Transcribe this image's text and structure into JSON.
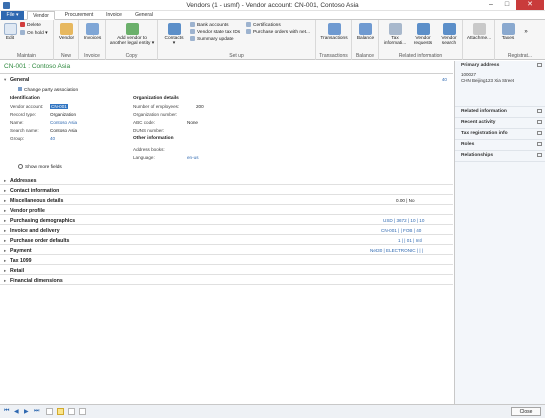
{
  "window": {
    "title": "Vendors (1 - usmf) - Vendor account: CN-001, Contoso Asia"
  },
  "tabs": [
    {
      "label": "File",
      "arrow": "▾"
    },
    {
      "label": "Vendor"
    },
    {
      "label": "Procurement"
    },
    {
      "label": "Invoice"
    },
    {
      "label": "General"
    }
  ],
  "ribbon": {
    "maintain": {
      "label": "Maintain",
      "edit": "Edit",
      "delete": "Delete",
      "on_hold": "On hold"
    },
    "new": {
      "label": "New",
      "vendor": "Vendor"
    },
    "invoice": {
      "label": "Invoice",
      "invoices": "Invoices"
    },
    "copy": {
      "label": "Copy",
      "add_vendor_line1": "Add vendor to",
      "add_vendor_line2": "another legal entity"
    },
    "setup": {
      "label": "Set up",
      "contacts": "Contacts",
      "bank_accounts": "Bank accounts",
      "vendor_state_tax": "Vendor state tax IDs",
      "summary_update": "Summary update",
      "certifications": "Certifications",
      "purchase_orders_net": "Purchase orders with net..."
    },
    "transactions": {
      "label": "Transactions",
      "btn": "Transactions"
    },
    "balance": {
      "label": "Balance",
      "btn": "Balance"
    },
    "tax": {
      "btn_line1": "Tax",
      "btn_line2": "informati..."
    },
    "related": {
      "label": "Related information",
      "vendor_requests_line1": "Vendor",
      "vendor_requests_line2": "requests",
      "vendor_search_line1": "Vendor",
      "vendor_search_line2": "search"
    },
    "attachments": {
      "btn": "Attachme..."
    },
    "registration": {
      "label": "Registrat...",
      "taxes": "Taxes"
    }
  },
  "record": {
    "title": "CN-001 : Contoso Asia"
  },
  "general": {
    "title": "General",
    "summary": "40",
    "change_party": "Change party association",
    "identification": {
      "heading": "Identification",
      "rows": [
        {
          "label": "Vendor account:",
          "value": "CN-001"
        },
        {
          "label": "Record type:",
          "value": "Organization"
        },
        {
          "label": "Name:",
          "value": "Contoso Asia"
        },
        {
          "label": "Search name:",
          "value": "Contoso Asia"
        },
        {
          "label": "Group:",
          "value": "40"
        }
      ]
    },
    "org_details": {
      "heading": "Organization details",
      "rows": [
        {
          "label": "Number of employees:",
          "value": "200"
        },
        {
          "label": "Organization number:",
          "value": ""
        },
        {
          "label": "ABC code:",
          "value": "None"
        },
        {
          "label": "DUNS number:",
          "value": ""
        }
      ]
    },
    "other_info": {
      "heading": "Other information",
      "rows": [
        {
          "label": "Address books:",
          "value": ""
        },
        {
          "label": "Language:",
          "value": "en-us"
        }
      ]
    },
    "show_more": "Show more fields"
  },
  "fasttabs": [
    {
      "title": "Addresses",
      "summary": ""
    },
    {
      "title": "Contact information",
      "summary": ""
    },
    {
      "title": "Miscellaneous details",
      "summary": "0.00  |  No"
    },
    {
      "title": "Vendor profile",
      "summary": ""
    },
    {
      "title": "Purchasing demographics",
      "summary": "USD  |  3672  |  10  |  10"
    },
    {
      "title": "Invoice and delivery",
      "summary": "CN-001  |  |  FOB  |  40"
    },
    {
      "title": "Purchase order defaults",
      "summary": "1  |  |  01  |  Intl"
    },
    {
      "title": "Payment",
      "summary": "Net30  |  ELECTRONIC  |  |  |"
    },
    {
      "title": "Tax 1099",
      "summary": ""
    },
    {
      "title": "Retail",
      "summary": ""
    },
    {
      "title": "Financial dimensions",
      "summary": ""
    }
  ],
  "factbox": {
    "primary_address": {
      "title": "Primary address",
      "line1": "100027",
      "line2": "CHN Beijing123 Xia Street"
    },
    "related_information": "Related information",
    "recent_activity": "Recent activity",
    "tax_registration": "Tax registration info",
    "roles": "Roles",
    "relationships": "Relationships"
  },
  "statusbar": {
    "close": "Close"
  },
  "colors": {
    "accent": "#2e68b0",
    "record_title": "#2f8a3f",
    "close_red": "#c93b3b"
  }
}
